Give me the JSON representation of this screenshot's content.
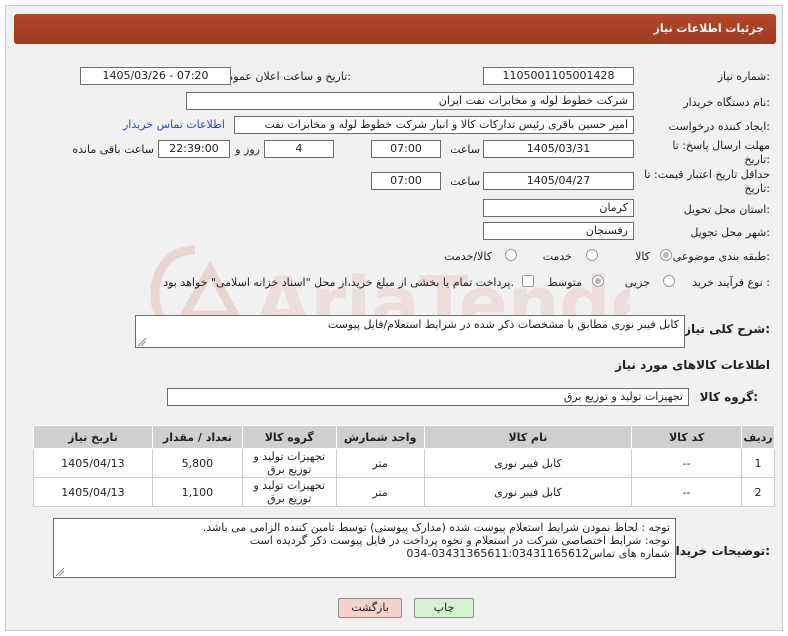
{
  "page": {
    "title": "جزئیات اطلاعات نیاز"
  },
  "watermark": {
    "text": "AriaTender.neT"
  },
  "fields": {
    "need_number": {
      "label": "شماره نیاز:",
      "value": "1105001105001428"
    },
    "announce_datetime": {
      "label": "تاریخ و ساعت اعلان عمومی:",
      "value": "1405/03/26 - 07:20"
    },
    "buyer_org": {
      "label": "نام دستگاه خریدار:",
      "value": "شرکت خطوط لوله و مخابرات نفت ایران"
    },
    "requester": {
      "label": "ایجاد کننده درخواست:",
      "value": "امیر حسین  باقری  رئیس تدارکات کالا و انبار  شرکت خطوط لوله و مخابرات نفت"
    },
    "buyer_contact_link": "اطلاعات تماس خریدار",
    "reply_deadline": {
      "label": "مهلت ارسال پاسخ: تا تاریخ:",
      "date": "1405/03/31",
      "time_label": "ساعت",
      "time": "07:00",
      "days": "4",
      "days_label": "روز و",
      "remaining": "22:39:00",
      "remaining_label": "ساعت باقی مانده"
    },
    "price_validity": {
      "label": "حداقل تاریخ اعتبار قیمت: تا تاریخ:",
      "date": "1405/04/27",
      "time_label": "ساعت",
      "time": "07:00"
    },
    "delivery_province": {
      "label": "استان محل تحویل:",
      "value": "کرمان"
    },
    "delivery_city": {
      "label": "شهر محل تحویل:",
      "value": "رفسنجان"
    },
    "category": {
      "label": "طبقه بندی موضوعی:",
      "options": [
        "کالا",
        "خدمت",
        "کالا/خدمت"
      ],
      "selected": "کالا"
    },
    "purchase_process": {
      "label": "نوع فرآیند خرید :",
      "options": [
        "جزیی",
        "متوسط"
      ],
      "selected": "متوسط",
      "note": "پرداخت تمام یا بخشی از مبلغ خرید،از محل \"اسناد خزانه اسلامی\" خواهد بود."
    },
    "general_description": {
      "label": "شرح کلی نیاز:",
      "value": "کابل فیبر نوری مطابق با مشخصات ذکر شده در شرایط استعلام/فایل پیوست"
    }
  },
  "goods_section": {
    "title": "اطلاعات کالاهای مورد نیاز",
    "group_label": "گروه کالا:",
    "group_value": "تجهیزات تولید و توزیع برق"
  },
  "table": {
    "headers": [
      "ردیف",
      "کد کالا",
      "نام کالا",
      "واحد شمارش",
      "گروه کالا",
      "تعداد / مقدار",
      "تاریخ نیاز"
    ],
    "rows": [
      [
        "1",
        "--",
        "کابل فیبر نوری",
        "متر",
        "تجهیزات تولید و توزیع برق",
        "5,800",
        "1405/04/13"
      ],
      [
        "2",
        "--",
        "کابل فیبر نوری",
        "متر",
        "تجهیزات تولید و توزیع برق",
        "1,100",
        "1405/04/13"
      ]
    ]
  },
  "buyer_notes": {
    "label": "توضیحات خریدار:",
    "lines": [
      "توجه : لحاظ نمودن شرایط استعلام پیوست شده (مدارک پیوستی) توسط تامین کننده الزامی می باشد.",
      "توجه: شرایط اختصاصی شرکت در استعلام و نحوه پرداخت در فایل پیوست ذکر گردیده است",
      "شماره های تماس03431365611:03431165612-034"
    ]
  },
  "buttons": {
    "print": "چاپ",
    "back": "بازگشت"
  },
  "colors": {
    "title_bar": "#a8401f",
    "link": "#1a4fd0",
    "back_button": "#f6d2cf",
    "print_button": "#d6f2d0"
  }
}
